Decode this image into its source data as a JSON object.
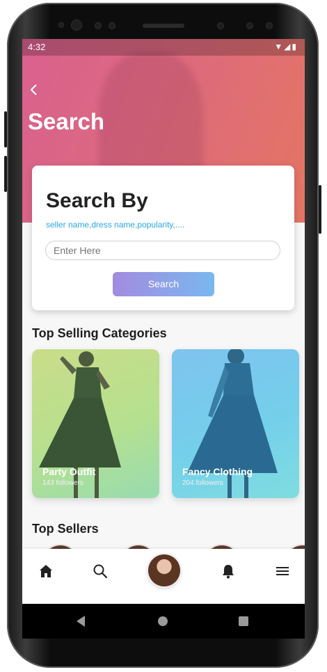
{
  "status": {
    "time": "4:32",
    "icons": "▼◢▮"
  },
  "header": {
    "back_icon": "chevron-left-icon",
    "title": "Search"
  },
  "search_card": {
    "heading": "Search By",
    "hint": "seller name,dress name,popularity,....",
    "input_placeholder": "Enter Here",
    "button_label": "Search"
  },
  "categories": {
    "title": "Top Selling Categories",
    "items": [
      {
        "name": "Party Outfit",
        "followers": "143 followers"
      },
      {
        "name": "Fancy Clothing",
        "followers": "204 followers"
      }
    ]
  },
  "sellers": {
    "title": "Top Sellers"
  },
  "bottom_nav": {
    "items": [
      "home-icon",
      "search-icon",
      "profile-avatar",
      "bell-icon",
      "menu-icon"
    ]
  },
  "colors": {
    "header_start": "#d9618f",
    "header_end": "#e47563",
    "hint": "#2aa7e0",
    "button_start": "#a38bdf",
    "button_end": "#7ab8ef"
  }
}
